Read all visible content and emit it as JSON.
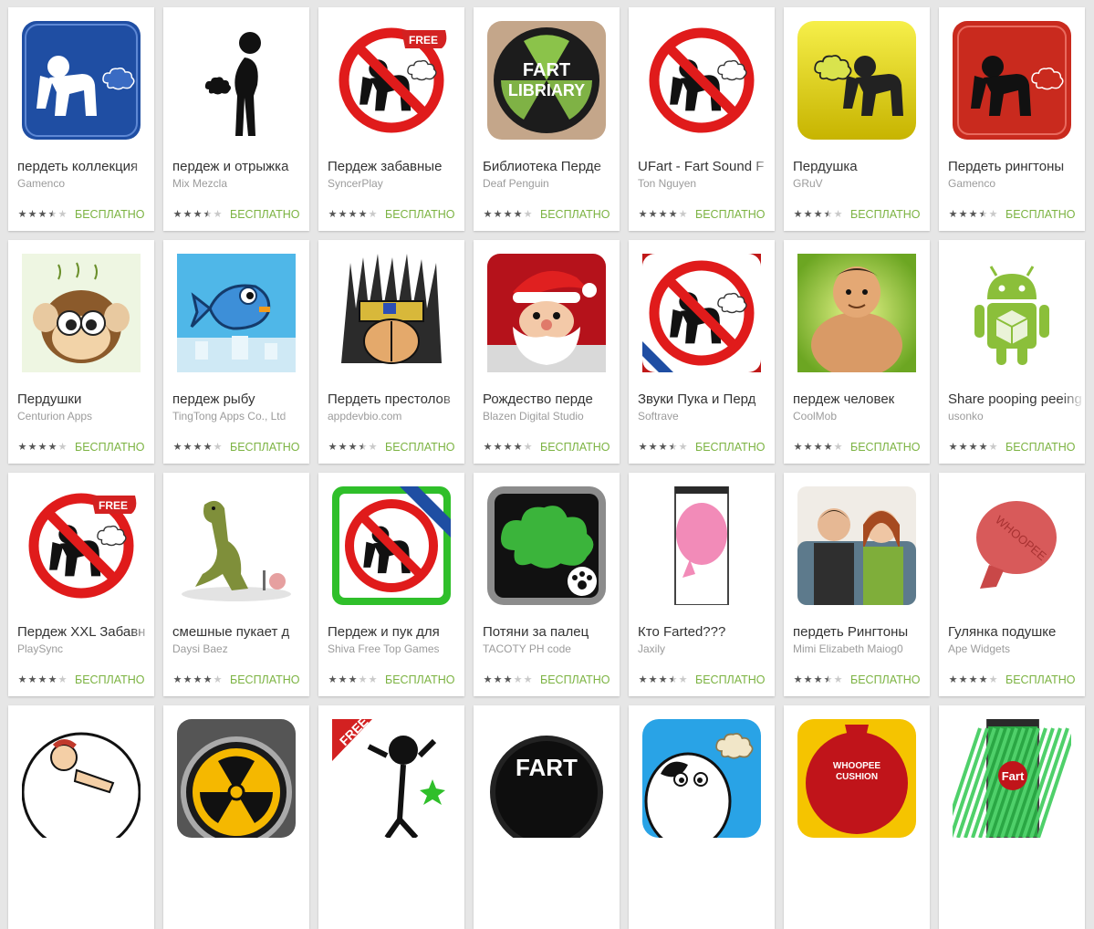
{
  "price_label": "БЕСПЛАТНО",
  "colors": {
    "background": "#e6e6e6",
    "card": "#ffffff",
    "price_green": "#7cb342",
    "developer_gray": "#9b9b9b"
  },
  "rows": [
    [
      {
        "title": "пердеть коллекция",
        "developer": "Gamenco",
        "rating": 3.5,
        "icon": "squatting-man-blue-icon"
      },
      {
        "title": "пердеж и отрыжка",
        "developer": "Mix Mezcla",
        "rating": 3.5,
        "icon": "stick-figure-cloud-icon"
      },
      {
        "title": "Пердеж забавные",
        "developer": "SyncerPlay",
        "rating": 4,
        "icon": "no-fart-sign-free-icon"
      },
      {
        "title": "Библиотека Перде",
        "developer": "Deaf Penguin",
        "rating": 4,
        "icon": "fart-library-radiation-icon",
        "icon_text": "FART LIBRIARY"
      },
      {
        "title": "UFart - Fart Sound F",
        "developer": "Ton Nguyen",
        "rating": 4,
        "icon": "no-fart-sign-icon"
      },
      {
        "title": "Пердушка",
        "developer": "GRuV",
        "rating": 3.5,
        "icon": "yellow-fart-man-icon"
      },
      {
        "title": "Пердеть рингтоны",
        "developer": "Gamenco",
        "rating": 3.5,
        "icon": "red-squatting-man-icon"
      }
    ],
    [
      {
        "title": "Пердушки",
        "developer": "Centurion Apps",
        "rating": 4,
        "icon": "monkey-cartoon-icon"
      },
      {
        "title": "пердеж рыбу",
        "developer": "TingTong Apps Co., Ltd",
        "rating": 4,
        "icon": "pixel-fish-icon"
      },
      {
        "title": "Пердеть престолов",
        "developer": "appdevbio.com",
        "rating": 3.5,
        "icon": "throne-crown-icon"
      },
      {
        "title": "Рождество перде",
        "developer": "Blazen Digital Studio",
        "rating": 4,
        "icon": "santa-face-icon"
      },
      {
        "title": "Звуки Пука и Перд",
        "developer": "Softrave",
        "rating": 3.5,
        "icon": "no-fart-sign-free-ribbon-icon"
      },
      {
        "title": "пердеж человек",
        "developer": "CoolMob",
        "rating": 4,
        "icon": "fat-man-icon"
      },
      {
        "title": "Share pooping peeing",
        "developer": "usonko",
        "rating": 4,
        "icon": "android-robot-icon"
      }
    ],
    [
      {
        "title": "Пердеж XXL Забавн",
        "developer": "PlaySync",
        "rating": 4,
        "icon": "no-fart-sign-free-icon"
      },
      {
        "title": "смешные пукает д",
        "developer": "Daysi Baez",
        "rating": 4,
        "icon": "dinosaur-icon"
      },
      {
        "title": "Пердеж и пук для",
        "developer": "Shiva Free Top Games",
        "rating": 3,
        "icon": "no-fart-green-free-icon"
      },
      {
        "title": "Потяни за палец",
        "developer": "TACOTY PH code",
        "rating": 3,
        "icon": "green-cloud-paw-icon"
      },
      {
        "title": "Кто Farted???",
        "developer": "Jaxily",
        "rating": 3.5,
        "icon": "pink-balloon-phone-icon"
      },
      {
        "title": "пердеть Рингтоны",
        "developer": "Mimi Elizabeth Maiog0",
        "rating": 3.5,
        "icon": "laughing-people-photo-icon"
      },
      {
        "title": "Гулянка подушке",
        "developer": "Ape Widgets",
        "rating": 4,
        "icon": "whoopee-cushion-icon",
        "icon_text": "WHOOPEE"
      }
    ],
    [
      {
        "title": "",
        "developer": "",
        "rating": 0,
        "icon": "cartoon-man-icon"
      },
      {
        "title": "",
        "developer": "",
        "rating": 0,
        "icon": "radiation-button-icon"
      },
      {
        "title": "",
        "developer": "",
        "rating": 0,
        "icon": "free-stick-figure-icon",
        "icon_text": "FREE"
      },
      {
        "title": "",
        "developer": "",
        "rating": 0,
        "icon": "fart-button-icon",
        "icon_text": "FART"
      },
      {
        "title": "",
        "developer": "",
        "rating": 0,
        "icon": "cow-cartoon-icon"
      },
      {
        "title": "",
        "developer": "",
        "rating": 0,
        "icon": "whoopee-cushion-red-icon",
        "icon_text": "WHOOPEE CUSHION"
      },
      {
        "title": "",
        "developer": "",
        "rating": 0,
        "icon": "fart-phone-green-icon",
        "icon_text": "Fart"
      }
    ]
  ]
}
